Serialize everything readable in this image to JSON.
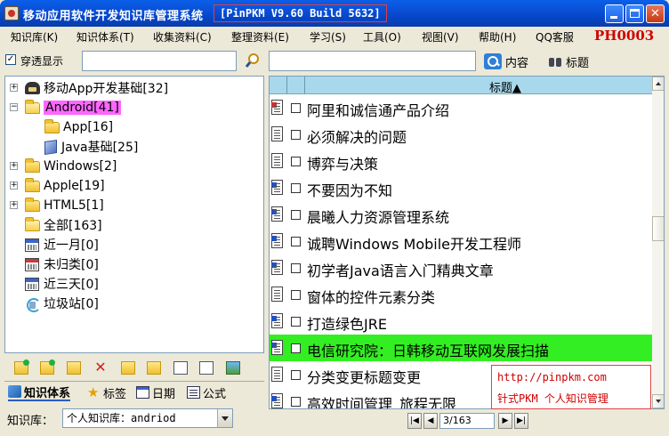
{
  "window": {
    "title": "移动应用软件开发知识库管理系统",
    "build": "[PinPKM V9.60 Build 5632]"
  },
  "menu": {
    "items": [
      "知识库(K)",
      "知识体系(T)",
      "收集资料(C)",
      "整理资料(E)",
      "学习(S)",
      "工具(O)",
      "视图(V)",
      "帮助(H)",
      "QQ客服"
    ],
    "code": "PH0003"
  },
  "search": {
    "transparent_label": "穿透显示",
    "transparent_checked": "✓",
    "content_button": "内容",
    "title_button": "标题"
  },
  "tree": {
    "items": [
      {
        "label": "移动App开发基础[32]",
        "icon": "phone-icon"
      },
      {
        "label": "Android[41]",
        "icon": "folder-open-icon"
      },
      {
        "label": "App[16]",
        "icon": "folder-icon"
      },
      {
        "label": "Java基础[25]",
        "icon": "cube-icon"
      },
      {
        "label": "Windows[2]",
        "icon": "folder-icon"
      },
      {
        "label": "Apple[19]",
        "icon": "folder-icon"
      },
      {
        "label": "HTML5[1]",
        "icon": "folder-icon"
      },
      {
        "label": "全部[163]",
        "icon": "folder-open-icon"
      },
      {
        "label": "近一月[0]",
        "icon": "calendar-icon"
      },
      {
        "label": "未归类[0]",
        "icon": "calendar-icon"
      },
      {
        "label": "近三天[0]",
        "icon": "calendar-icon"
      },
      {
        "label": "垃圾站[0]",
        "icon": "recycle-icon"
      }
    ]
  },
  "left_tabs": [
    "知识体系",
    "标签",
    "日期",
    "公式"
  ],
  "kb": {
    "label": "知识库：",
    "value": "个人知识库：andriod"
  },
  "list": {
    "header_title": "标题▲",
    "rows": [
      "阿里和诚信通产品介绍",
      "必须解决的问题",
      "博弈与决策",
      "不要因为不知",
      "晨曦人力资源管理系统",
      "诚聘Windows Mobile开发工程师",
      "初学者Java语言入门精典文章",
      "窗体的控件元素分类",
      "打造绿色JRE",
      "电信研究院：日韩移动互联网发展扫描",
      "分类变更标题变更",
      "高效时间管理_旅程无限"
    ],
    "highlight_color": "#33ee22"
  },
  "promo": {
    "url": "http://pinpkm.com",
    "text": "针式PKM 个人知识管理"
  },
  "pager": {
    "value": "3/163"
  }
}
